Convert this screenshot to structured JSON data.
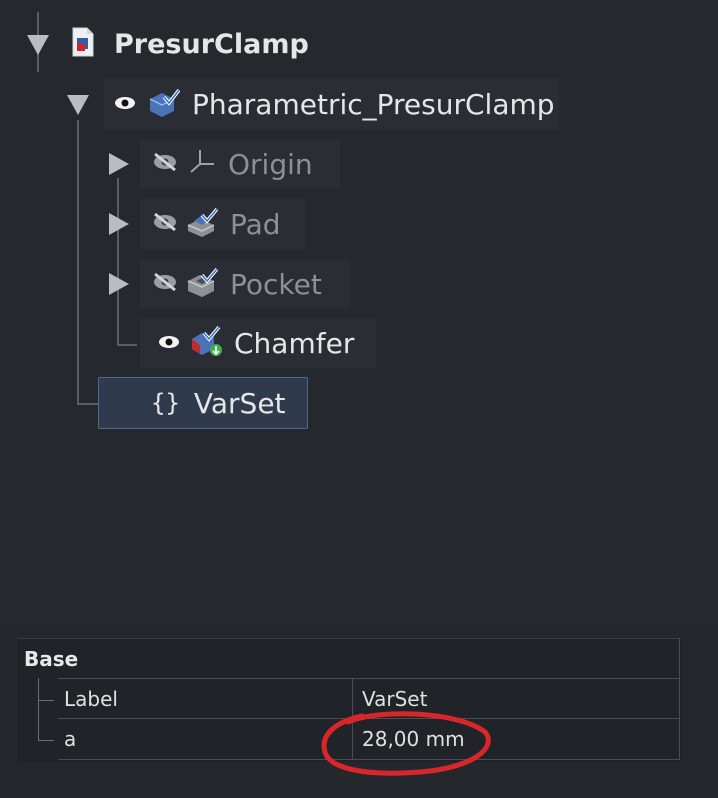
{
  "tree": {
    "root": {
      "label": "PresurClamp"
    },
    "body": {
      "label": "Pharametric_PresurClamp"
    },
    "children": [
      {
        "label": "Origin",
        "icon": "origin-icon"
      },
      {
        "label": "Pad",
        "icon": "pad-icon"
      },
      {
        "label": "Pocket",
        "icon": "pocket-icon"
      },
      {
        "label": "Chamfer",
        "icon": "chamfer-icon"
      }
    ],
    "varset": {
      "label": "VarSet",
      "icon": "braces-icon",
      "glyph": "{}"
    }
  },
  "properties": {
    "group": "Base",
    "rows": [
      {
        "name": "Label",
        "value": "VarSet"
      },
      {
        "name": "a",
        "value": "28,00 mm"
      }
    ]
  },
  "colors": {
    "background": "#25282d",
    "selection": "#2f3b4c",
    "annotation": "#d8262b"
  }
}
